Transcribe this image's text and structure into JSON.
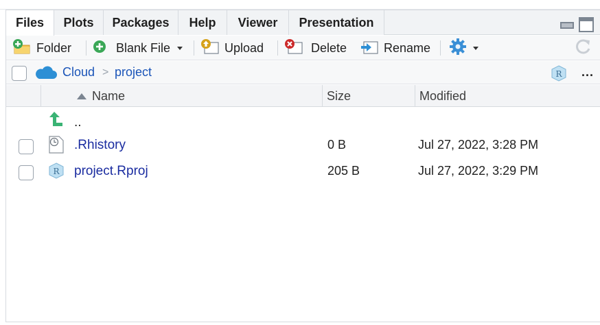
{
  "tabs": [
    {
      "label": "Files",
      "active": true
    },
    {
      "label": "Plots",
      "active": false
    },
    {
      "label": "Packages",
      "active": false
    },
    {
      "label": "Help",
      "active": false
    },
    {
      "label": "Viewer",
      "active": false
    },
    {
      "label": "Presentation",
      "active": false
    }
  ],
  "toolbar": {
    "folder_label": "Folder",
    "blank_file_label": "Blank File",
    "upload_label": "Upload",
    "delete_label": "Delete",
    "rename_label": "Rename"
  },
  "breadcrumb": {
    "root": "Cloud",
    "separator": ">",
    "current": "project",
    "more": "..."
  },
  "columns": {
    "name": "Name",
    "size": "Size",
    "modified": "Modified"
  },
  "up_dir_label": "..",
  "files": [
    {
      "name": ".Rhistory",
      "size": "0 B",
      "modified": "Jul 27, 2022, 3:28 PM",
      "icon": "history-file-icon"
    },
    {
      "name": "project.Rproj",
      "size": "205 B",
      "modified": "Jul 27, 2022, 3:29 PM",
      "icon": "rproj-file-icon"
    }
  ],
  "colors": {
    "link": "#1a54b8",
    "file_link": "#1a2ca0",
    "accent_green": "#3aa757",
    "delete_red": "#cc2a2a",
    "cloud_blue": "#2d8fd5"
  }
}
